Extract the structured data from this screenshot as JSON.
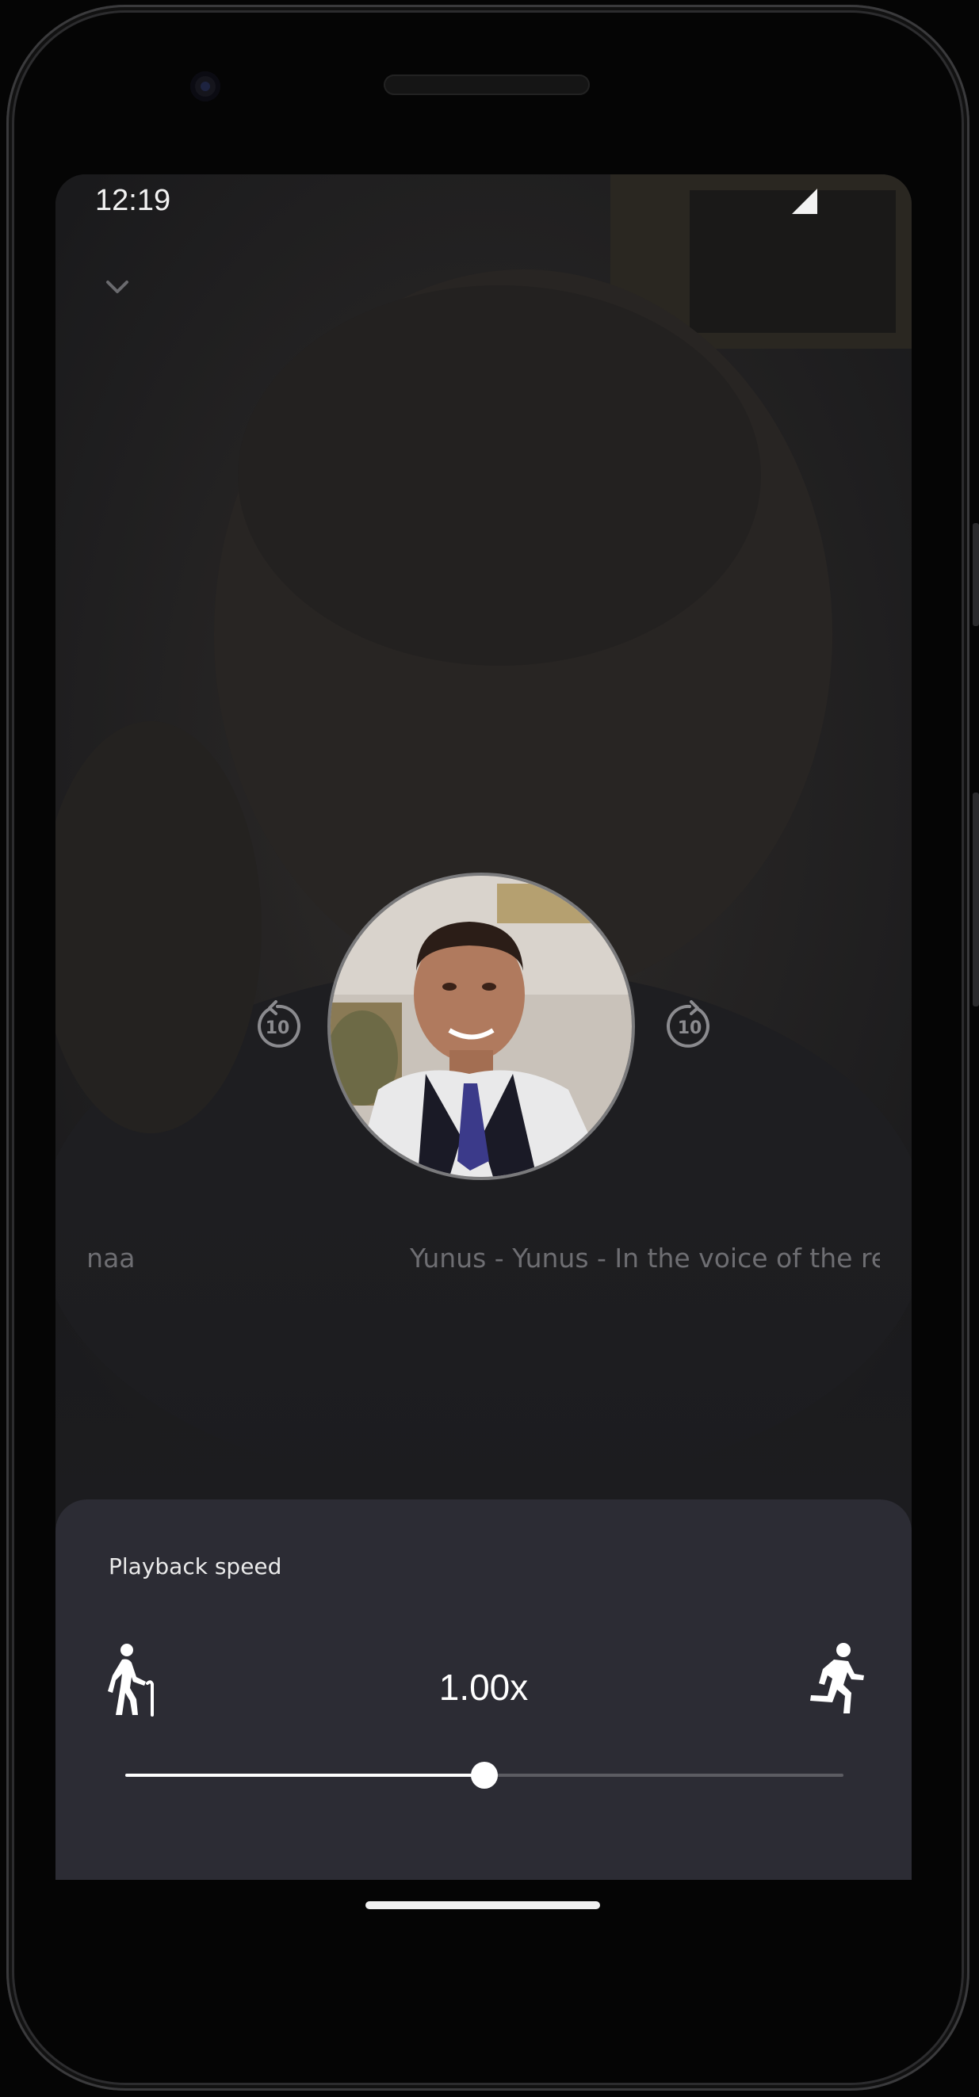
{
  "status_bar": {
    "time": "12:19"
  },
  "header": {
    "collapse_icon": "chevron-down-icon"
  },
  "player": {
    "skip_back_label": "10",
    "skip_forward_label": "10",
    "marquee_previous": "inaa",
    "marquee_current": "Yunus  - Yunus - In the voice of the re"
  },
  "speed_sheet": {
    "title": "Playback speed",
    "value_label": "1.00x",
    "slow_icon": "walking-elder-icon",
    "fast_icon": "running-person-icon",
    "slider_fraction": 0.5
  },
  "colors": {
    "sheet_background": "#2c2c34",
    "screen_background": "#1c1c1f",
    "accent": "#ffffff"
  }
}
